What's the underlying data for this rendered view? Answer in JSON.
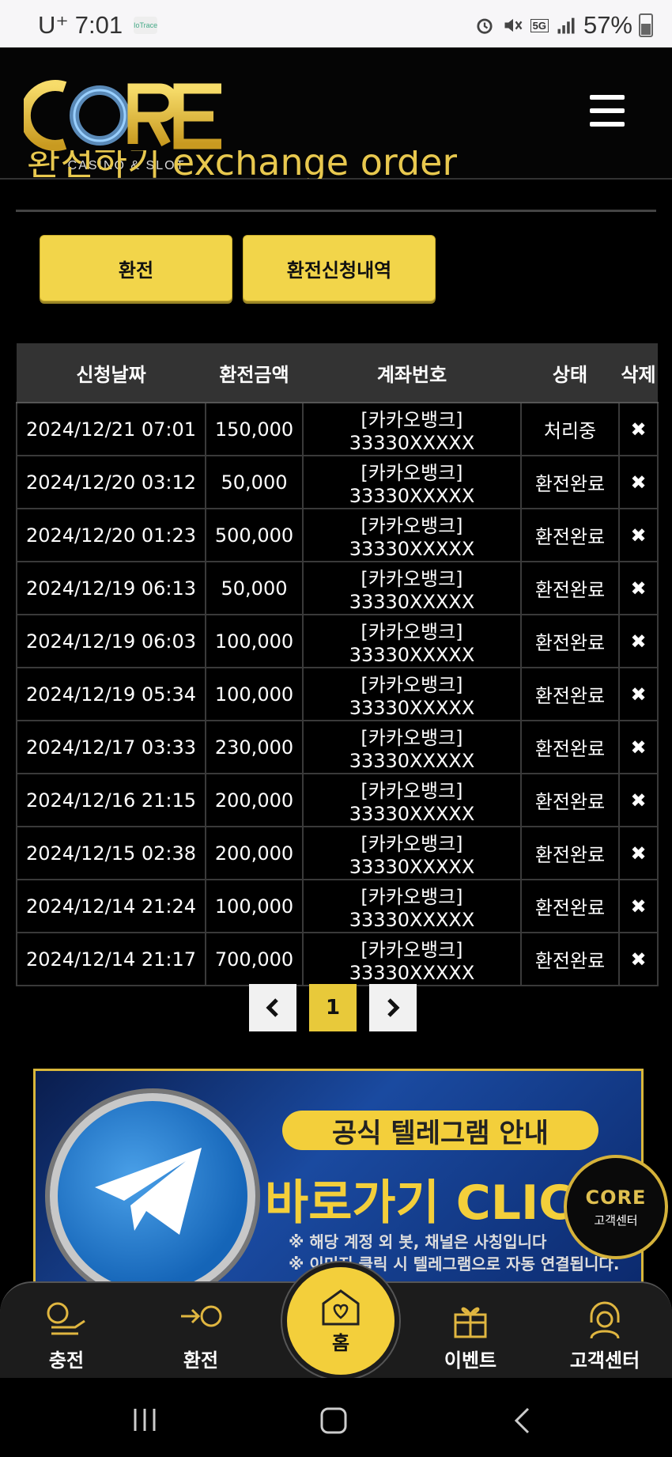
{
  "status_bar": {
    "carrier": "U⁺",
    "time": "7:01",
    "mini_app": "IoTrace",
    "network": "5G",
    "battery": "57%"
  },
  "header": {
    "logo_text": "CORE",
    "logo_sub": "CASINO & SLOT"
  },
  "page": {
    "title": "환전하기 exchange order"
  },
  "tabs": {
    "exchange": "환전",
    "history": "환전신청내역"
  },
  "table": {
    "columns": [
      "신청날짜",
      "환전금액",
      "계좌번호",
      "상태",
      "삭제"
    ],
    "rows": [
      {
        "date": "2024/12/21 07:01",
        "amount": "150,000",
        "account": "[카카오뱅크] 33330XXXXX",
        "status": "처리중",
        "del": "✖"
      },
      {
        "date": "2024/12/20 03:12",
        "amount": "50,000",
        "account": "[카카오뱅크] 33330XXXXX",
        "status": "환전완료",
        "del": "✖"
      },
      {
        "date": "2024/12/20 01:23",
        "amount": "500,000",
        "account": "[카카오뱅크] 33330XXXXX",
        "status": "환전완료",
        "del": "✖"
      },
      {
        "date": "2024/12/19 06:13",
        "amount": "50,000",
        "account": "[카카오뱅크] 33330XXXXX",
        "status": "환전완료",
        "del": "✖"
      },
      {
        "date": "2024/12/19 06:03",
        "amount": "100,000",
        "account": "[카카오뱅크] 33330XXXXX",
        "status": "환전완료",
        "del": "✖"
      },
      {
        "date": "2024/12/19 05:34",
        "amount": "100,000",
        "account": "[카카오뱅크] 33330XXXXX",
        "status": "환전완료",
        "del": "✖"
      },
      {
        "date": "2024/12/17 03:33",
        "amount": "230,000",
        "account": "[카카오뱅크] 33330XXXXX",
        "status": "환전완료",
        "del": "✖"
      },
      {
        "date": "2024/12/16 21:15",
        "amount": "200,000",
        "account": "[카카오뱅크] 33330XXXXX",
        "status": "환전완료",
        "del": "✖"
      },
      {
        "date": "2024/12/15 02:38",
        "amount": "200,000",
        "account": "[카카오뱅크] 33330XXXXX",
        "status": "환전완료",
        "del": "✖"
      },
      {
        "date": "2024/12/14 21:24",
        "amount": "100,000",
        "account": "[카카오뱅크] 33330XXXXX",
        "status": "환전완료",
        "del": "✖"
      },
      {
        "date": "2024/12/14 21:17",
        "amount": "700,000",
        "account": "[카카오뱅크] 33330XXXXX",
        "status": "환전완료",
        "del": "✖"
      }
    ]
  },
  "pagination": {
    "prev": "‹",
    "current": "1",
    "next": "›"
  },
  "banner": {
    "tag": "공식 텔레그램 안내",
    "headline": "바로가기 CLICK",
    "note1": "※ 해당 계정 외 봇, 채널은 사칭입니다",
    "note2": "※ 이미지 클릭 시 텔레그램으로 자동 연결됩니다."
  },
  "floating_support": {
    "logo": "CORE",
    "label": "고객센터"
  },
  "bottom_nav": {
    "charge": "충전",
    "exchange": "환전",
    "home": "홈",
    "event": "이벤트",
    "support": "고객센터"
  },
  "colors": {
    "accent": "#f2d54a",
    "link": "#6f9fe0",
    "background": "#000000"
  }
}
